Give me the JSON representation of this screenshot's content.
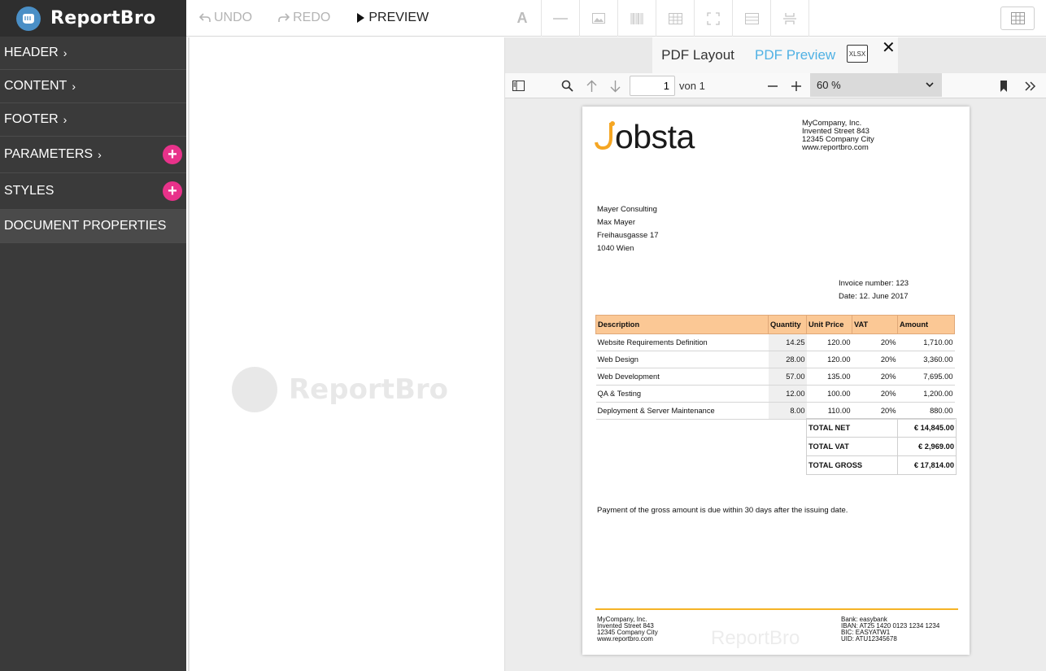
{
  "app": {
    "name": "ReportBro"
  },
  "sidebar": {
    "items": [
      {
        "label": "HEADER",
        "chevron": "›"
      },
      {
        "label": "CONTENT",
        "chevron": "›"
      },
      {
        "label": "FOOTER",
        "chevron": "›"
      },
      {
        "label": "PARAMETERS",
        "chevron": "›"
      },
      {
        "label": "STYLES",
        "chevron": ""
      },
      {
        "label": "DOCUMENT PROPERTIES",
        "chevron": ""
      }
    ],
    "add_symbol": "+"
  },
  "toolbar": {
    "undo_label": "UNDO",
    "redo_label": "REDO",
    "preview_label": "PREVIEW",
    "tool_text_glyph": "A"
  },
  "canvas": {
    "watermark_text": "ReportBro"
  },
  "preview": {
    "tabs": [
      {
        "label": "PDF Layout"
      },
      {
        "label": "PDF Preview"
      }
    ],
    "xlsx_label": "XLSX",
    "close_symbol": "✕",
    "viewer": {
      "page_number": "1",
      "page_of": "von 1",
      "zoom": "60 %"
    }
  },
  "document": {
    "brand": "obsta",
    "company_lines": [
      "MyCompany, Inc.",
      "Invented Street 843",
      "12345 Company City",
      "www.reportbro.com"
    ],
    "recipient_lines": [
      "Mayer Consulting",
      "Max Mayer",
      "Freihausgasse 17",
      "1040 Wien"
    ],
    "invoice_number": "Invoice number: 123",
    "invoice_date": "Date: 12. June 2017",
    "columns": [
      "Description",
      "Quantity",
      "Unit Price",
      "VAT",
      "Amount"
    ],
    "rows": [
      [
        "Website Requirements Definition",
        "14.25",
        "120.00",
        "20%",
        "1,710.00"
      ],
      [
        "Web Design",
        "28.00",
        "120.00",
        "20%",
        "3,360.00"
      ],
      [
        "Web Development",
        "57.00",
        "135.00",
        "20%",
        "7,695.00"
      ],
      [
        "QA & Testing",
        "12.00",
        "100.00",
        "20%",
        "1,200.00"
      ],
      [
        "Deployment & Server Maintenance",
        "8.00",
        "110.00",
        "20%",
        "880.00"
      ]
    ],
    "totals": [
      {
        "label": "TOTAL NET",
        "value": "€ 14,845.00"
      },
      {
        "label": "TOTAL VAT",
        "value": "€ 2,969.00"
      },
      {
        "label": "TOTAL GROSS",
        "value": "€ 17,814.00"
      }
    ],
    "payment_note": "Payment of the gross amount is due within 30 days after the issuing date.",
    "footer_left": [
      "MyCompany, Inc.",
      "Invented Street 843",
      "12345 Company City",
      "www.reportbro.com"
    ],
    "footer_right": [
      "Bank: easybank",
      "IBAN: AT25 1420 0123 1234 1234",
      "BIC: EASYATW1",
      "UID: ATU12345678"
    ],
    "footer_watermark": "ReportBro"
  },
  "colors": {
    "sidebar_bg": "#3a3a3a",
    "accent_pink": "#e8328a",
    "accent_blue": "#4fb1e4",
    "table_header": "#fbc895",
    "footer_line": "#f5b326",
    "brand_ring": "#f5a623"
  }
}
